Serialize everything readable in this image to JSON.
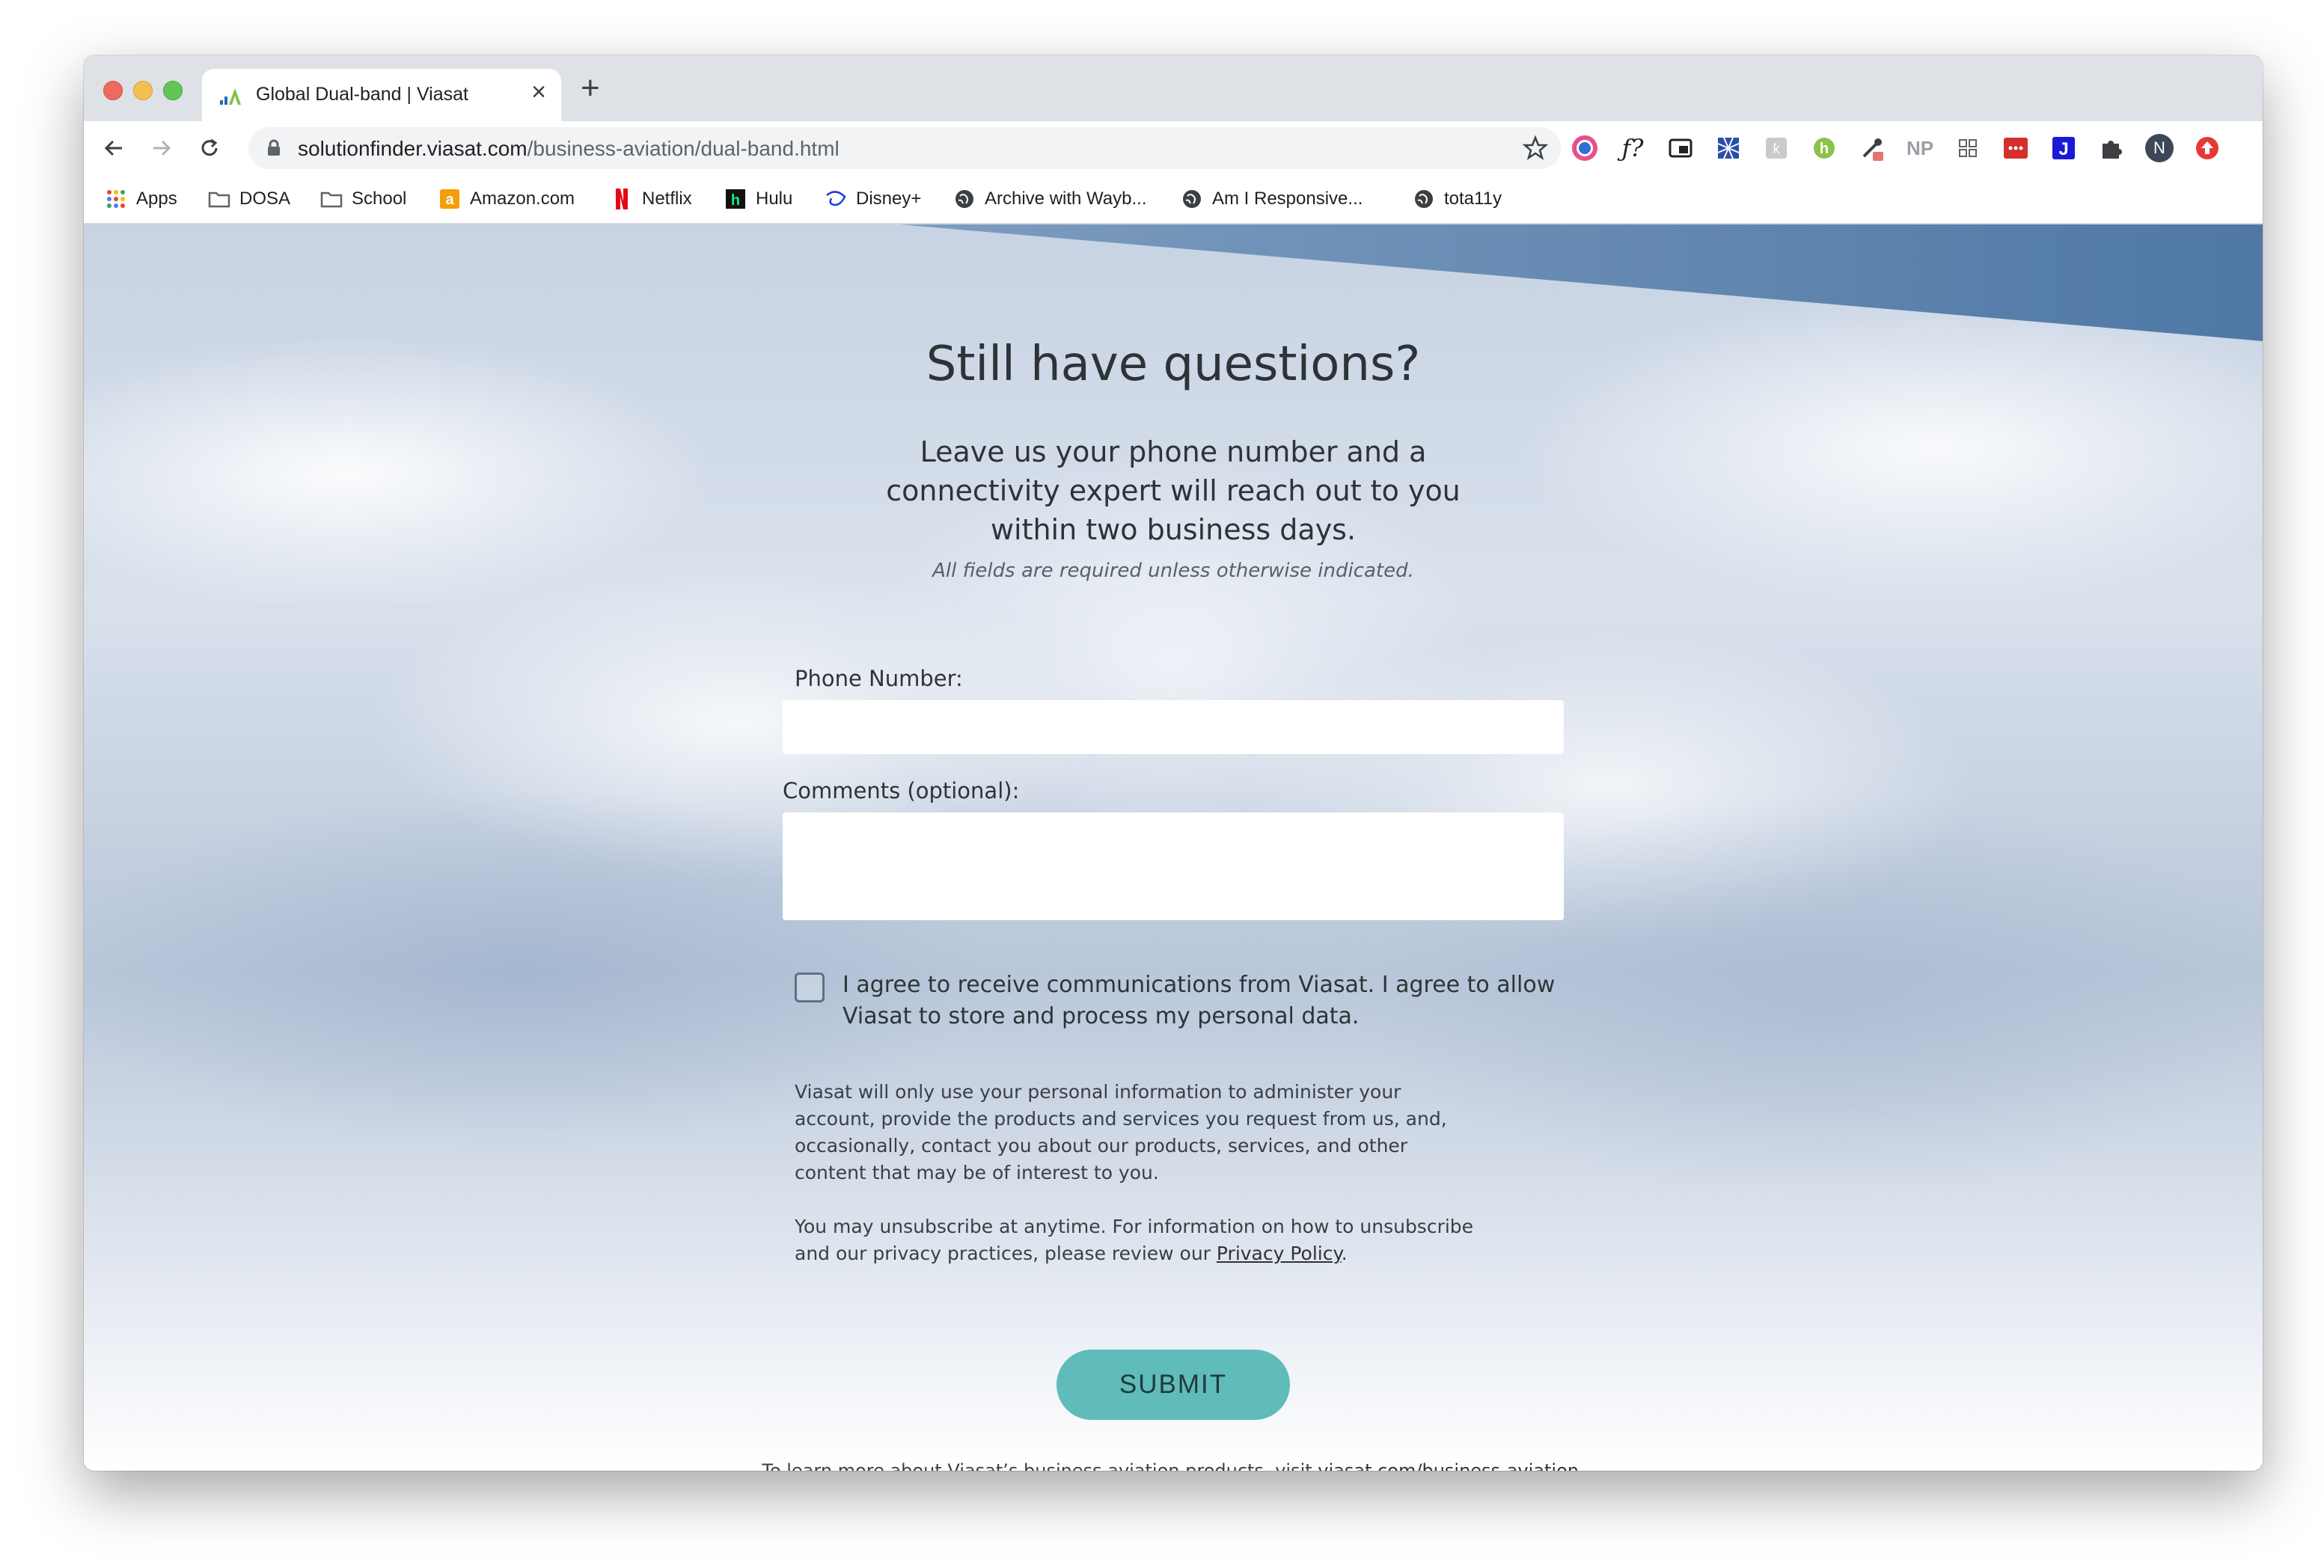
{
  "browser": {
    "tab": {
      "title": "Global Dual-band | Viasat"
    },
    "url": {
      "domain": "solutionfinder.viasat.com",
      "path": "/business-aviation/dual-band.html"
    },
    "profile_initial": "N",
    "extensions": [
      "color-picker-icon",
      "font-finder-icon",
      "picture-in-picture-icon",
      "pattern-extension-icon",
      "grey-extension-icon",
      "green-h-extension-icon",
      "eyedropper-extension-icon",
      "np-extension-icon",
      "grid-extension-icon",
      "red-dots-extension-icon",
      "blue-j-extension-icon",
      "puzzle-icon"
    ],
    "np_label": "NP",
    "bookmarks": [
      {
        "label": "Apps",
        "icon": "apps-grid-icon"
      },
      {
        "label": "DOSA",
        "icon": "folder-icon"
      },
      {
        "label": "School",
        "icon": "folder-icon"
      },
      {
        "label": "Amazon.com",
        "icon": "amazon-icon"
      },
      {
        "label": "Netflix",
        "icon": "netflix-icon"
      },
      {
        "label": "Hulu",
        "icon": "hulu-icon"
      },
      {
        "label": "Disney+",
        "icon": "disney-icon"
      },
      {
        "label": "Archive with Wayb...",
        "icon": "globe-icon"
      },
      {
        "label": "Am I Responsive...",
        "icon": "globe-icon"
      },
      {
        "label": "tota11y",
        "icon": "globe-icon"
      }
    ]
  },
  "form": {
    "heading": "Still have questions?",
    "subheading": "Leave us your phone number and a connectivity expert will reach out to you within two business days.",
    "required_note": "All fields are required unless otherwise indicated.",
    "phone_label": "Phone Number:",
    "phone_value": "",
    "comments_label": "Comments (optional):",
    "comments_value": "",
    "consent_text": "I agree to receive communications from Viasat. I agree to allow Viasat to store and process my personal data.",
    "privacy_p1": "Viasat will only use your personal information to administer your account, provide the products and services you request from us, and, occasionally, contact you about our products, services, and other content that may be of interest to you.",
    "privacy_p2_prefix": "You may unsubscribe at anytime. For information on how to unsubscribe and our privacy practices, please review our ",
    "privacy_link": "Privacy Policy",
    "privacy_p2_suffix": ".",
    "submit_label": "SUBMIT"
  },
  "footer": {
    "prefix": "To learn more about Viasat’s business aviation products, visit ",
    "link": "viasat.com/business-aviation",
    "suffix": "."
  },
  "colors": {
    "submit_bg": "#5fbcb9",
    "banner_blue": "#4f78a6"
  }
}
